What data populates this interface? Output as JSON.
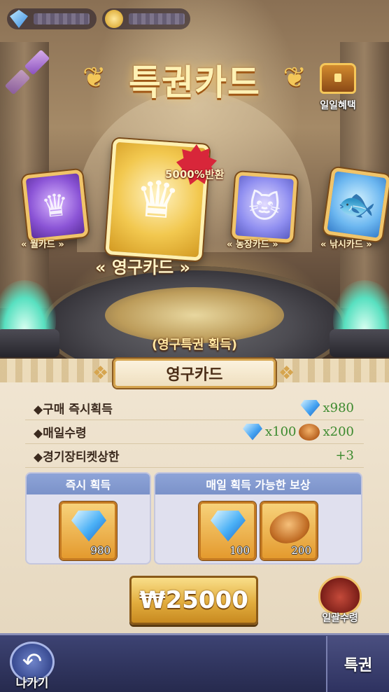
{
  "title": "특권카드",
  "daily_benefit": {
    "label": "일일혜택",
    "icon": "chest-icon"
  },
  "cards": {
    "monthly": {
      "label": "월카드"
    },
    "permanent": {
      "label": "영구카드",
      "bonus": "5000%반환"
    },
    "farm": {
      "label": "농장카드"
    },
    "fishing": {
      "label": "낚시카드"
    }
  },
  "acquire_text": "(영구특권 획득)",
  "panel": {
    "title": "영구카드",
    "info": [
      {
        "label": "◆구매 즉시획득",
        "values": [
          "x980"
        ]
      },
      {
        "label": "◆매일수령",
        "values": [
          "x100",
          "x200"
        ]
      },
      {
        "label": "◆경기장티켓상한",
        "values": [
          "+3"
        ]
      }
    ],
    "instant": {
      "header": "즉시 획득",
      "items": [
        {
          "icon": "diamond-icon",
          "qty": "980"
        }
      ]
    },
    "daily": {
      "header": "매일 획득 가능한 보상",
      "items": [
        {
          "icon": "diamond-icon",
          "qty": "100"
        },
        {
          "icon": "bread-icon",
          "qty": "200"
        }
      ]
    },
    "price": "₩25000",
    "oneclick": {
      "label": "일괄수령"
    }
  },
  "bottom": {
    "back": "나가기",
    "tab": "특권"
  },
  "colors": {
    "value_green": "#3c8a2e",
    "header_blue": "#7b92c9",
    "gold": "#e2ad3e"
  }
}
